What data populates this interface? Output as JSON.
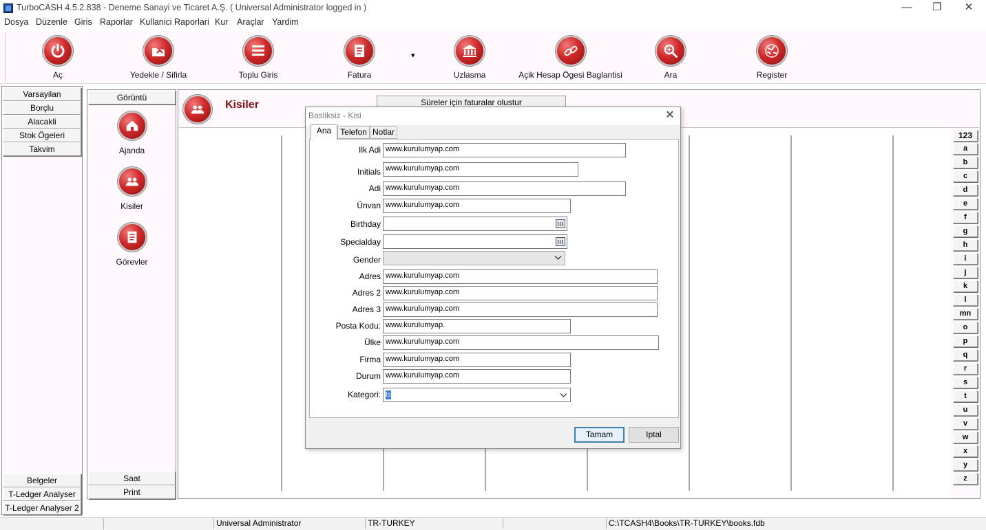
{
  "window": {
    "title": "TurboCASH 4.5.2.838  - Deneme Sanayi ve Ticaret A.Ş. ( Universal Administrator logged in )",
    "controls": {
      "minimize": "—",
      "restore": "❐",
      "close": "✕"
    }
  },
  "menu": [
    "Dosya",
    "Düzenle",
    "Giris",
    "Raporlar",
    "Kullanici Raporlari",
    "Kur",
    "Araçlar",
    "Yardim"
  ],
  "toolbar": {
    "open": "Aç",
    "backup": "Yedekle / Sifirla",
    "batch": "Toplu Giris",
    "invoice": "Fatura",
    "dropdown": "▾",
    "reconcile": "Uzlasma",
    "link": "Açik Hesap Ögesi Baglantisi",
    "search": "Ara",
    "register": "Register"
  },
  "left_nav": {
    "top": [
      "Varsayilan",
      "Borçlu",
      "Alacakli",
      "Stok Ögeleri",
      "Takvim"
    ],
    "bottom": [
      "Belgeler",
      "T-Ledger Analyser",
      "T-Ledger Analyser 2"
    ]
  },
  "mid_panel": {
    "header": "Görüntü",
    "tools": [
      "Ajanda",
      "Kisiler",
      "Görevler"
    ],
    "footer": [
      "Saat",
      "Print"
    ]
  },
  "main": {
    "title": "Kisiler",
    "action_button": "Süreler için faturalar olustur"
  },
  "alphabet": [
    "123",
    "a",
    "b",
    "c",
    "d",
    "e",
    "f",
    "g",
    "h",
    "i",
    "j",
    "k",
    "l",
    "mn",
    "o",
    "p",
    "q",
    "r",
    "s",
    "t",
    "u",
    "v",
    "w",
    "x",
    "y",
    "z"
  ],
  "status": {
    "user": "Universal Administrator",
    "locale": "TR-TURKEY",
    "path": "C:\\TCASH4\\Books\\TR-TURKEY\\books.fdb"
  },
  "dialog": {
    "title": "Basliksiz - Kisi",
    "close": "✕",
    "tabs": [
      "Ana",
      "Telefon",
      "Notlar"
    ],
    "fields": {
      "first_name": {
        "label": "Ilk Adi",
        "value": "www.kurulumyap.com"
      },
      "initials": {
        "label": "Initials",
        "value": "www.kurulumyap.com"
      },
      "name": {
        "label": "Adi",
        "value": "www.kurulumyap.com"
      },
      "title": {
        "label": "Ünvan",
        "value": "www.kurulumyap.com"
      },
      "birthday": {
        "label": "Birthday",
        "value": ""
      },
      "specialday": {
        "label": "Specialday",
        "value": ""
      },
      "gender": {
        "label": "Gender",
        "value": ""
      },
      "address": {
        "label": "Adres",
        "value": "www.kurulumyap.com"
      },
      "address2": {
        "label": "Adres 2",
        "value": "www.kurulumyap.com"
      },
      "address3": {
        "label": "Adres 3",
        "value": "www.kurulumyap.com"
      },
      "postal": {
        "label": "Posta Kodu:",
        "value": "www.kurulumyap."
      },
      "country": {
        "label": "Ülke",
        "value": "www.kurulumyap.com"
      },
      "company": {
        "label": "Firma",
        "value": "www.kurulumyap.com"
      },
      "status": {
        "label": "Durum",
        "value": "www.kurulumyap.com"
      },
      "category": {
        "label": "Kategori:",
        "value": "Is"
      }
    },
    "ok": "Tamam",
    "cancel": "Iptal"
  }
}
